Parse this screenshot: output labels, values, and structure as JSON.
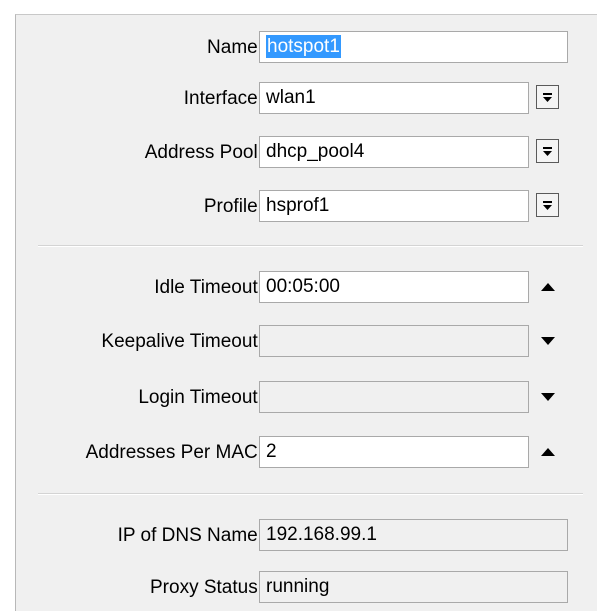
{
  "general": {
    "name": {
      "label": "Name:",
      "value": "hotspot1"
    },
    "interface": {
      "label": "Interface:",
      "value": "wlan1"
    },
    "address_pool": {
      "label": "Address Pool:",
      "value": "dhcp_pool4"
    },
    "profile": {
      "label": "Profile:",
      "value": "hsprof1"
    }
  },
  "timeouts": {
    "idle_timeout": {
      "label": "Idle Timeout:",
      "value": "00:05:00"
    },
    "keepalive_timeout": {
      "label": "Keepalive Timeout:",
      "value": ""
    },
    "login_timeout": {
      "label": "Login Timeout:",
      "value": ""
    },
    "addresses_per_mac": {
      "label": "Addresses Per MAC:",
      "value": "2"
    }
  },
  "status": {
    "ip_of_dns_name": {
      "label": "IP of DNS Name:",
      "value": "192.168.99.1"
    },
    "proxy_status": {
      "label": "Proxy Status:",
      "value": "running"
    }
  },
  "icons": {
    "dropdown": "dropdown-arrow-icon",
    "expand": "triangle-up-icon",
    "collapse": "triangle-down-icon"
  },
  "colors": {
    "panel_bg": "#f0f0f0",
    "selection": "#3399ff",
    "field_border": "#a9a9a9"
  }
}
